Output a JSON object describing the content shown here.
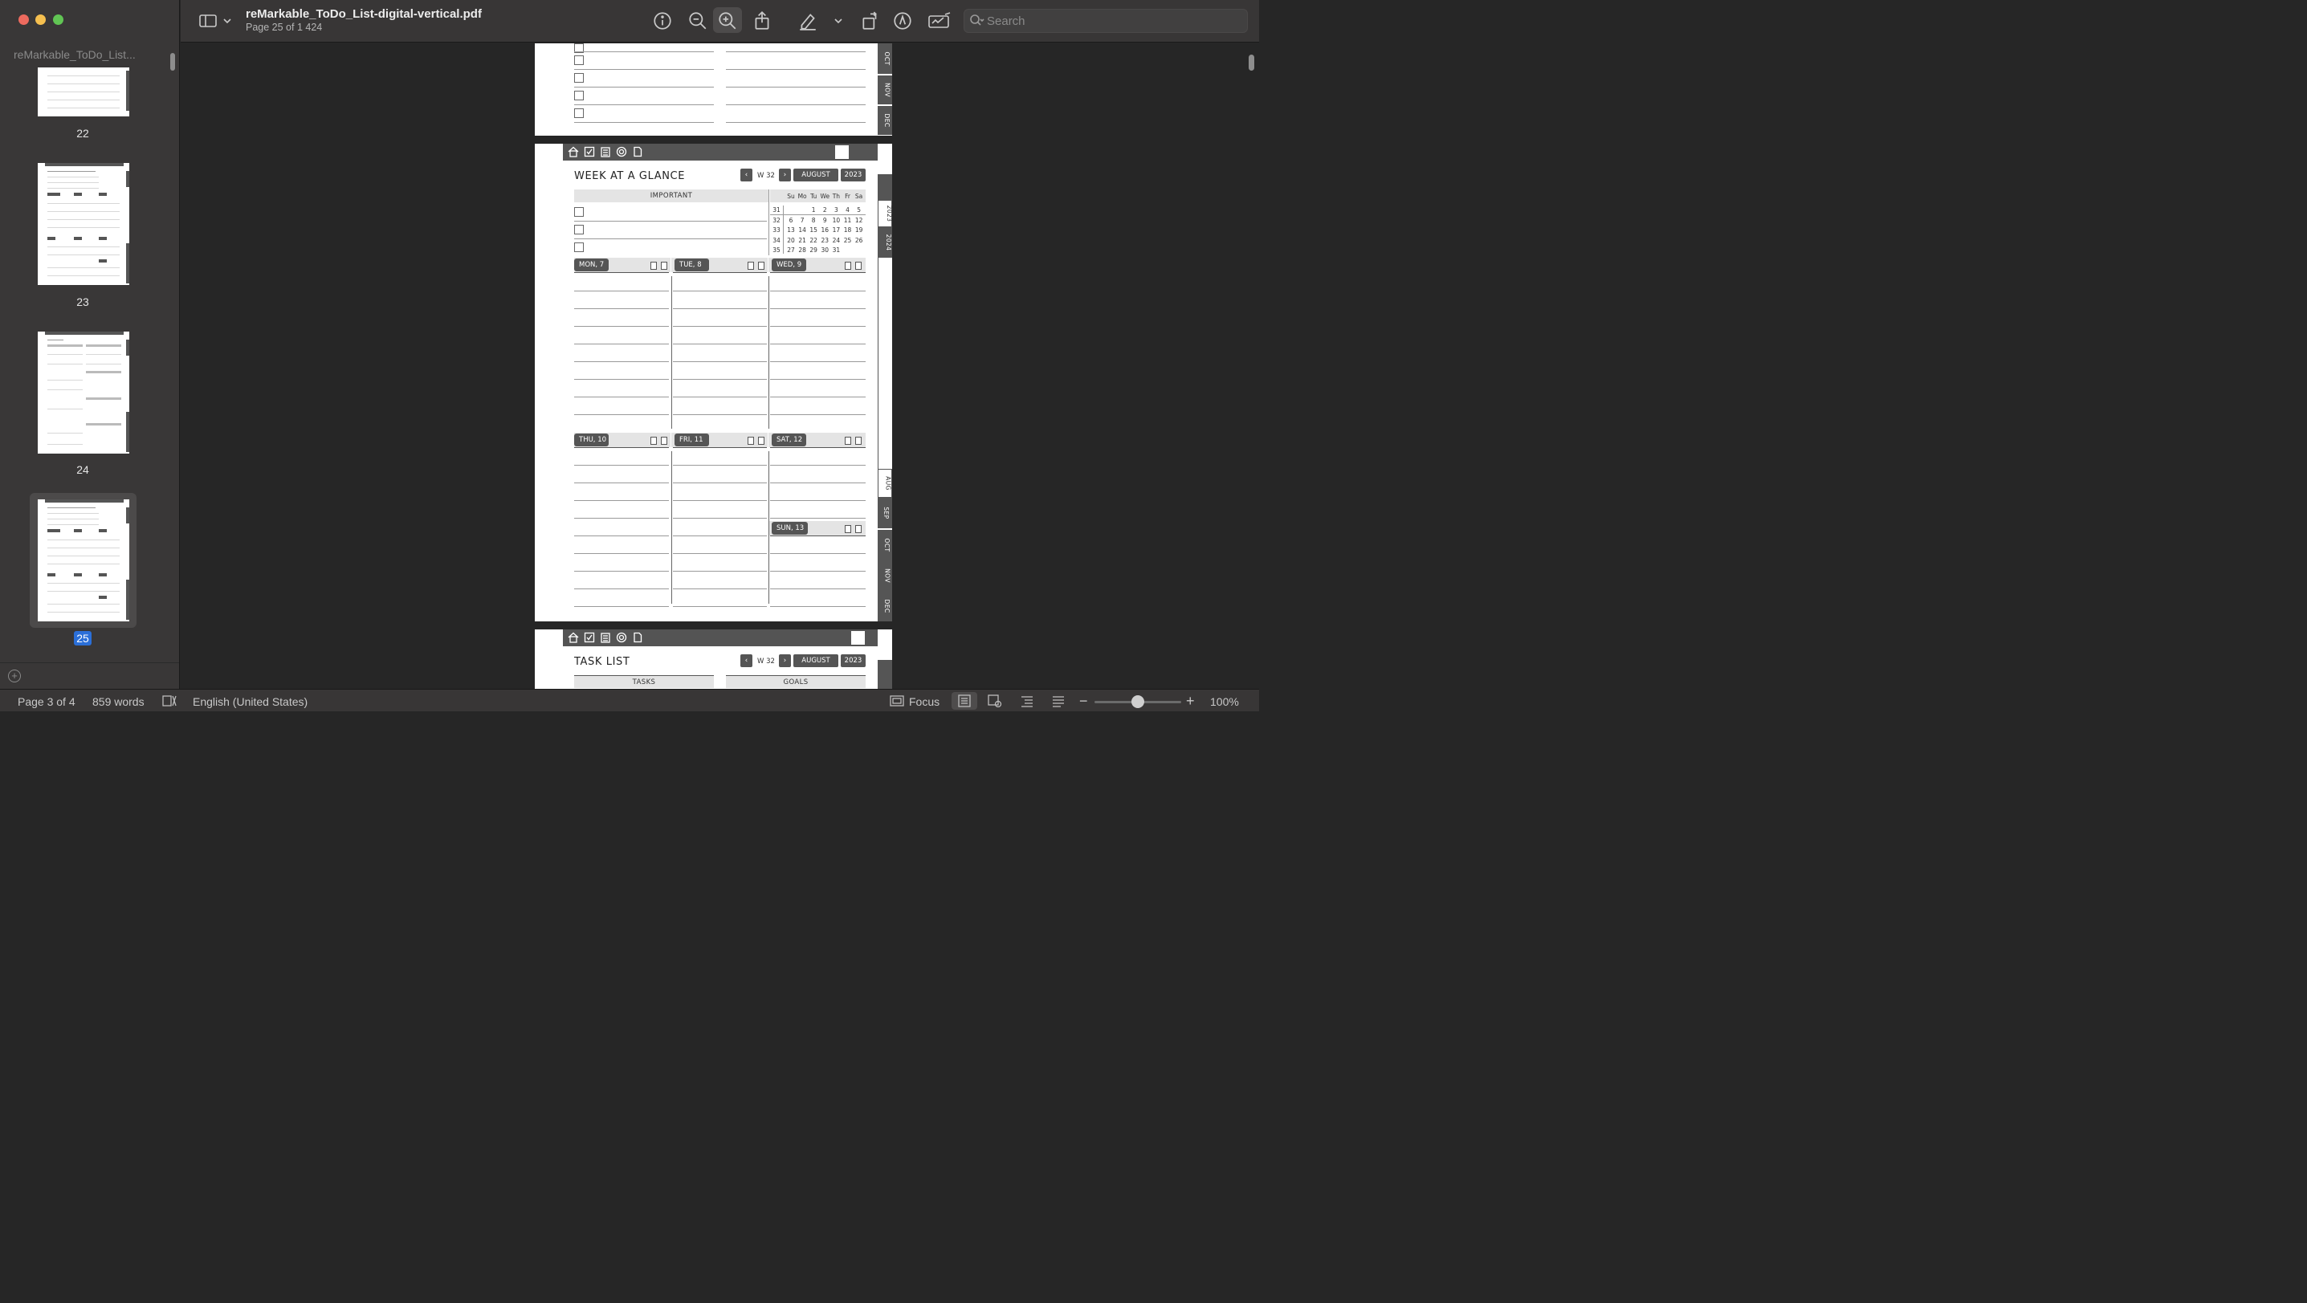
{
  "window": {
    "doc_title": "reMarkable_ToDo_List-digital-vertical.pdf",
    "doc_subtitle": "Page 25 of 1 424"
  },
  "toolbar": {
    "search_placeholder": "Search"
  },
  "sidebar": {
    "title": "reMarkable_ToDo_List...",
    "thumbs": [
      {
        "label": "22"
      },
      {
        "label": "23"
      },
      {
        "label": "24"
      },
      {
        "label": "25",
        "selected": true
      }
    ]
  },
  "page_top": {
    "tabs": [
      "OCT",
      "NOV",
      "DEC"
    ]
  },
  "page_main": {
    "title": "WEEK AT A GLANCE",
    "week": "W 32",
    "month": "AUGUST",
    "year": "2023",
    "important_label": "IMPORTANT",
    "cal_headers": [
      "Su",
      "Mo",
      "Tu",
      "We",
      "Th",
      "Fr",
      "Sa"
    ],
    "cal_rows": [
      {
        "wk": "31",
        "days": [
          "",
          "",
          "1",
          "2",
          "3",
          "4",
          "5"
        ]
      },
      {
        "wk": "32",
        "days": [
          "6",
          "7",
          "8",
          "9",
          "10",
          "11",
          "12"
        ]
      },
      {
        "wk": "33",
        "days": [
          "13",
          "14",
          "15",
          "16",
          "17",
          "18",
          "19"
        ]
      },
      {
        "wk": "34",
        "days": [
          "20",
          "21",
          "22",
          "23",
          "24",
          "25",
          "26"
        ]
      },
      {
        "wk": "35",
        "days": [
          "27",
          "28",
          "29",
          "30",
          "31",
          "",
          ""
        ]
      }
    ],
    "days": {
      "mon": "MON, 7",
      "tue": "TUE, 8",
      "wed": "WED, 9",
      "thu": "THU, 10",
      "fri": "FRI, 11",
      "sat": "SAT, 12",
      "sun": "SUN, 13"
    },
    "tabs_upper": [
      "2023",
      "2024"
    ],
    "tabs_lower": [
      "AUG",
      "SEP",
      "OCT",
      "NOV",
      "DEC"
    ]
  },
  "page_next": {
    "title": "TASK LIST",
    "week": "W 32",
    "month": "AUGUST",
    "year": "2023",
    "col_tasks": "TASKS",
    "col_goals": "GOALS"
  },
  "status": {
    "page": "Page 3 of 4",
    "words": "859 words",
    "language": "English (United States)",
    "focus": "Focus",
    "zoom": "100%",
    "zoom_level": 0.5
  }
}
